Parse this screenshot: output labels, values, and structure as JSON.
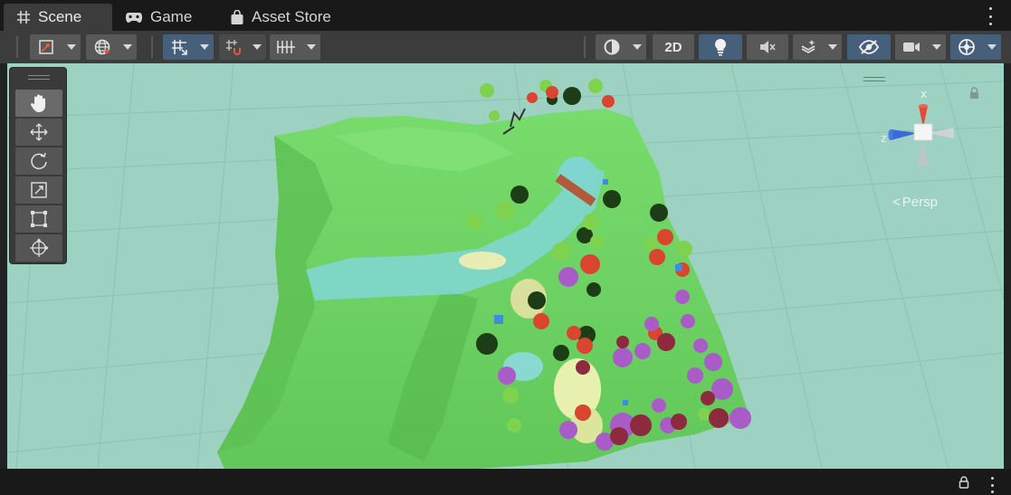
{
  "tabs": [
    {
      "label": "Scene",
      "icon": "grid-icon",
      "active": true
    },
    {
      "label": "Game",
      "icon": "gamepad-icon",
      "active": false
    },
    {
      "label": "Asset Store",
      "icon": "shopping-bag-icon",
      "active": false
    }
  ],
  "toolbar": {
    "mode_2d_label": "2D",
    "accent_on": "#46607c",
    "button_bg": "#585858"
  },
  "tools": [
    {
      "name": "hand-tool",
      "icon": "hand-icon"
    },
    {
      "name": "move-tool",
      "icon": "move-arrows-icon"
    },
    {
      "name": "rotate-tool",
      "icon": "rotate-icon"
    },
    {
      "name": "scale-tool",
      "icon": "scale-icon"
    },
    {
      "name": "rect-tool",
      "icon": "rect-transform-icon"
    },
    {
      "name": "transform-tool",
      "icon": "transform-icon"
    }
  ],
  "gizmo": {
    "x_label": "x",
    "z_label": "z",
    "persp_label": "Persp"
  },
  "viewport": {
    "background": "#9dd2c2",
    "terrain": "#72d466",
    "water": "#7fd6cf"
  }
}
